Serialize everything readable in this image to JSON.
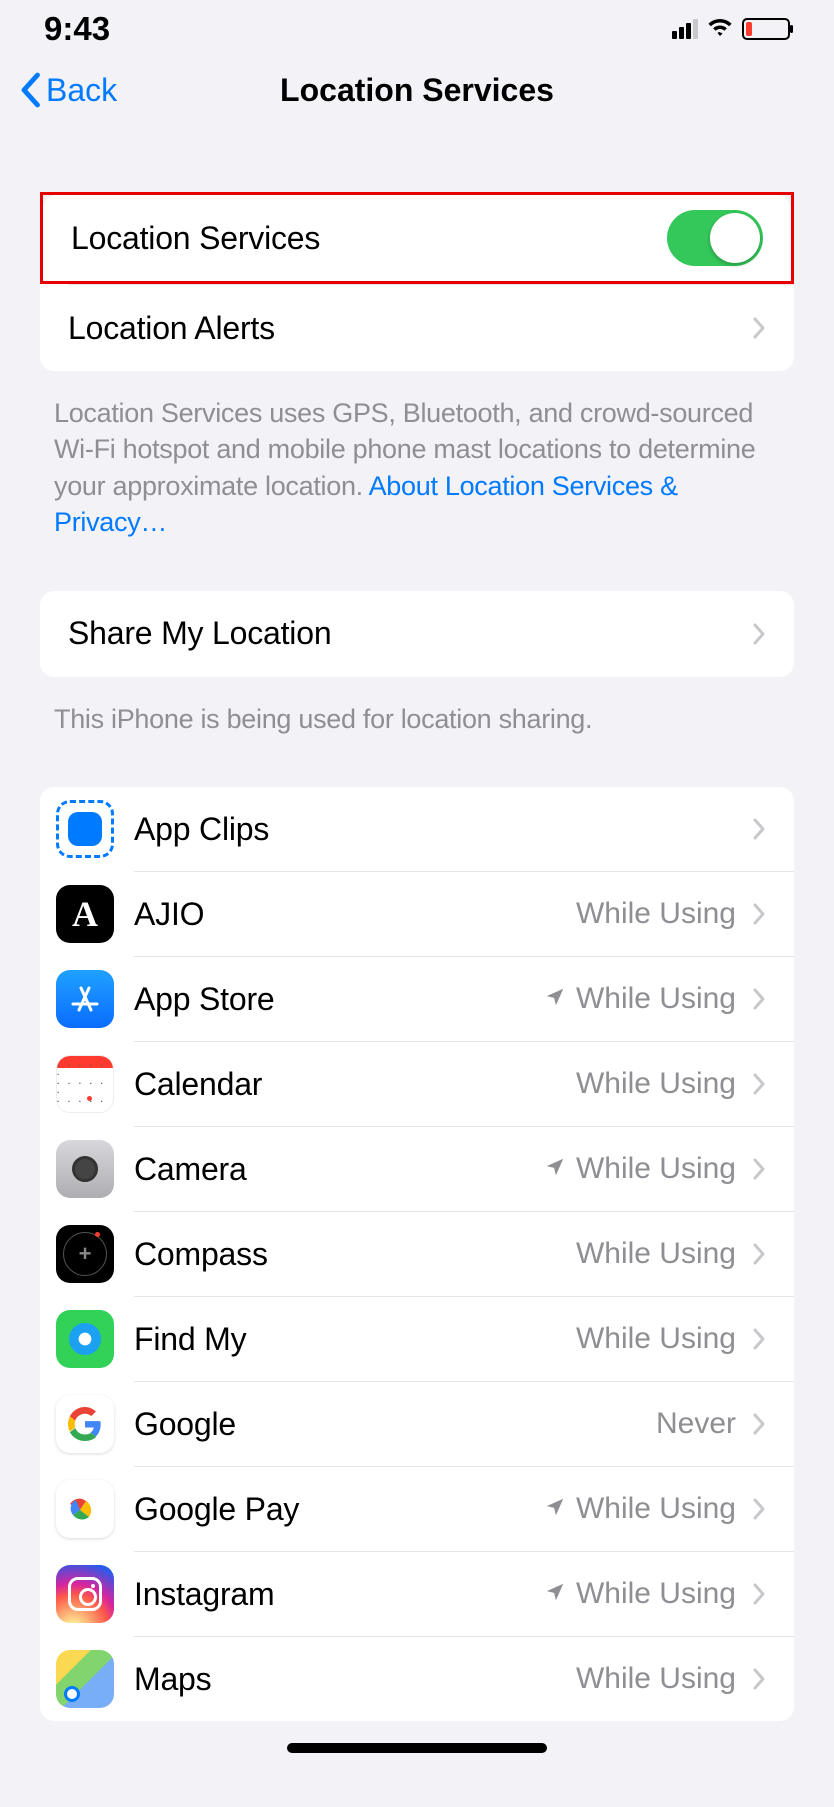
{
  "statusbar": {
    "time": "9:43"
  },
  "nav": {
    "back": "Back",
    "title": "Location Services"
  },
  "locservices": {
    "label": "Location Services",
    "on": true
  },
  "locationalerts": {
    "label": "Location Alerts"
  },
  "explain": {
    "text": "Location Services uses GPS, Bluetooth, and crowd-sourced Wi-Fi hotspot and mobile phone mast locations to determine your approximate location. ",
    "link": "About Location Services & Privacy…"
  },
  "sharemyloc": {
    "label": "Share My Location",
    "footer": "This iPhone is being used for location sharing."
  },
  "apps": [
    {
      "icon": "appclips",
      "name": "App Clips",
      "value": "",
      "arrow": false
    },
    {
      "icon": "ajio",
      "name": "AJIO",
      "value": "While Using",
      "arrow": false
    },
    {
      "icon": "appstore",
      "name": "App Store",
      "value": "While Using",
      "arrow": true
    },
    {
      "icon": "calendar",
      "name": "Calendar",
      "value": "While Using",
      "arrow": false
    },
    {
      "icon": "camera",
      "name": "Camera",
      "value": "While Using",
      "arrow": true
    },
    {
      "icon": "compass",
      "name": "Compass",
      "value": "While Using",
      "arrow": false
    },
    {
      "icon": "findmy",
      "name": "Find My",
      "value": "While Using",
      "arrow": false
    },
    {
      "icon": "google",
      "name": "Google",
      "value": "Never",
      "arrow": false
    },
    {
      "icon": "googlepay",
      "name": "Google Pay",
      "value": "While Using",
      "arrow": true
    },
    {
      "icon": "instagram",
      "name": "Instagram",
      "value": "While Using",
      "arrow": true
    },
    {
      "icon": "maps",
      "name": "Maps",
      "value": "While Using",
      "arrow": false
    }
  ]
}
